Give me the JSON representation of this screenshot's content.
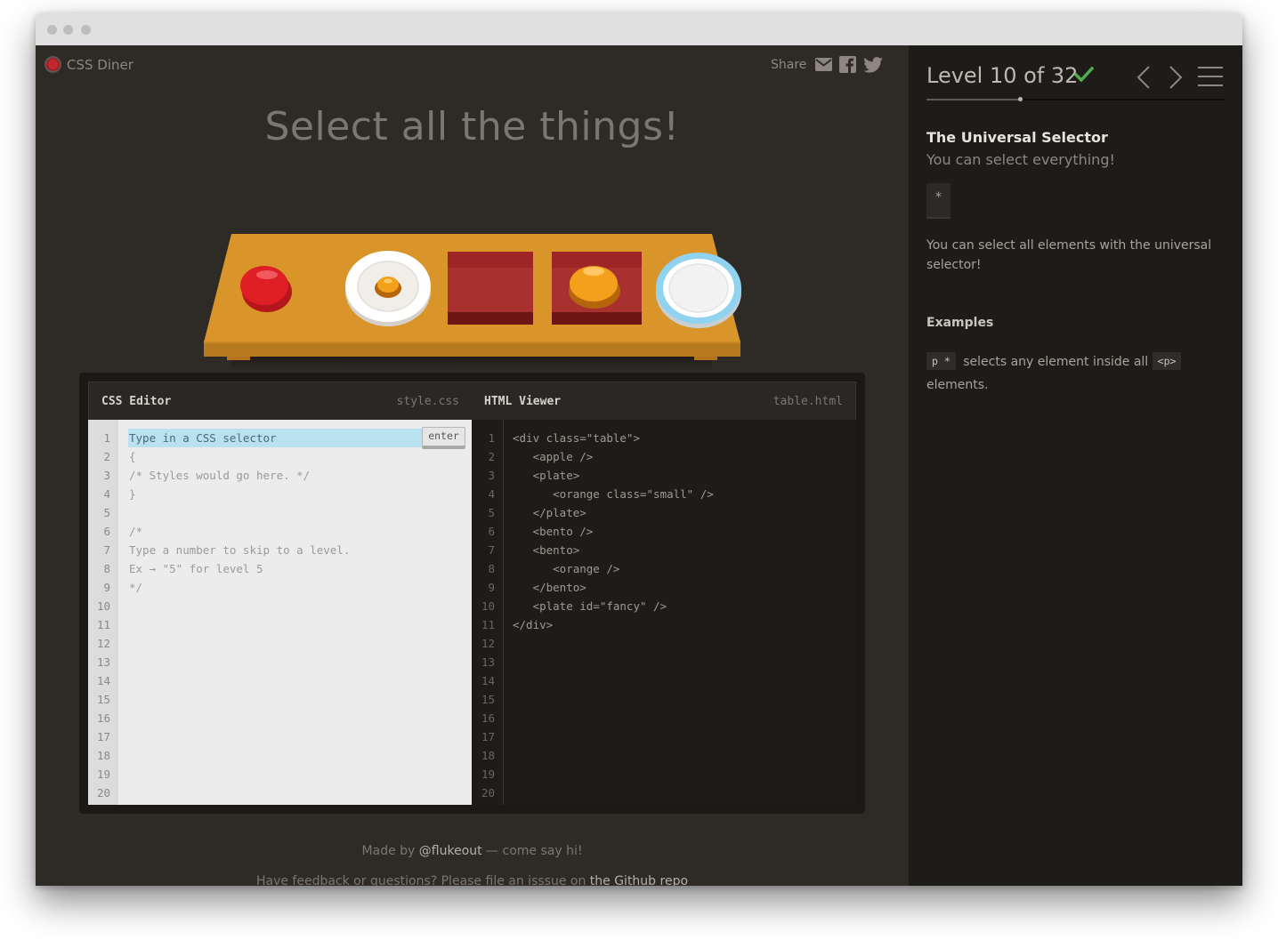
{
  "header": {
    "app_name": "CSS Diner",
    "share_label": "Share"
  },
  "page": {
    "instruction": "Select all the things!"
  },
  "editor": {
    "css_title": "CSS Editor",
    "css_file": "style.css",
    "html_title": "HTML Viewer",
    "html_file": "table.html",
    "input_placeholder": "Type in a CSS selector",
    "enter_label": "enter",
    "line_numbers": [
      "1",
      "2",
      "3",
      "4",
      "5",
      "6",
      "7",
      "8",
      "9",
      "10",
      "11",
      "12",
      "13",
      "14",
      "15",
      "16",
      "17",
      "18",
      "19",
      "20"
    ],
    "css_lines": [
      "{",
      "/* Styles would go here. */",
      "}",
      "",
      "/*",
      "Type a number to skip to a level.",
      "Ex → \"5\" for level 5",
      "*/"
    ],
    "html_lines": [
      "<div class=\"table\">",
      "   <apple />",
      "   <plate>",
      "      <orange class=\"small\" />",
      "   </plate>",
      "   <bento />",
      "   <bento>",
      "      <orange />",
      "   </bento>",
      "   <plate id=\"fancy\" />",
      "</div>"
    ]
  },
  "footer": {
    "made_by_prefix": "Made by ",
    "author": "@flukeout",
    "made_by_suffix": " — come say hi!",
    "feedback_prefix": "Have feedback or questions? Please file an isssue on ",
    "feedback_link": "the Github repo"
  },
  "sidebar": {
    "level_text": "Level 10 of 32",
    "level_current": 10,
    "level_total": 32,
    "completed": true,
    "selector_name": "The Universal Selector",
    "selector_syntax": "You can select everything!",
    "selector_code": "*",
    "description": "You can select all elements with the universal selector!",
    "examples_title": "Examples",
    "example_code": "p *",
    "example_text": " selects any element inside all ",
    "example_tag": "<p>",
    "example_end": " elements."
  },
  "colors": {
    "main_bg": "#2e2a26",
    "sidebar_bg": "#1e1c19",
    "check_green": "#4cae4c",
    "table_wood": "#d9952a",
    "input_highlight": "#b9e1f0"
  }
}
